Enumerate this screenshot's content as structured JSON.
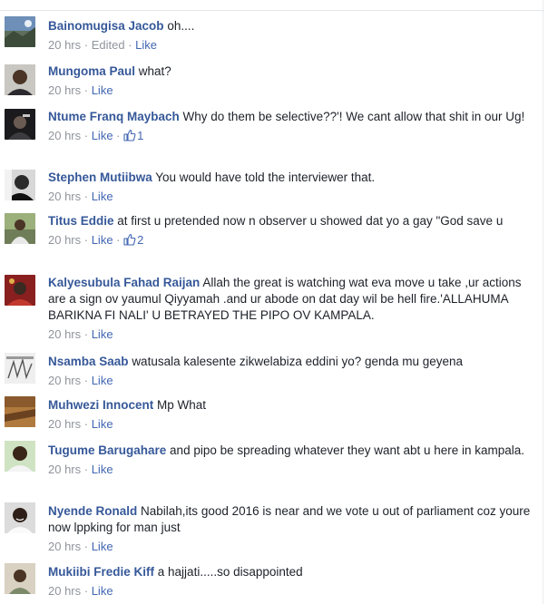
{
  "comments": [
    {
      "author": "Bainomugisa Jacob",
      "text": "oh....",
      "time": "20 hrs",
      "edited": "Edited",
      "like": "Like",
      "avatar": "landscape-photo-avatar"
    },
    {
      "author": "Mungoma Paul",
      "text": "what?",
      "time": "20 hrs",
      "like": "Like",
      "avatar": "portrait-avatar"
    },
    {
      "author": "Ntume Franq Maybach",
      "text": "Why do them be selective??'! We cant allow that shit in our Ug!",
      "time": "20 hrs",
      "like": "Like",
      "like_count": "1",
      "avatar": "dark-portrait-avatar"
    },
    {
      "author": "Stephen Mutiibwa",
      "text": "You would have told the interviewer that.",
      "time": "20 hrs",
      "like": "Like",
      "avatar": "bw-portrait-avatar"
    },
    {
      "author": "Titus Eddie",
      "text": "at first u pretended now n observer u showed dat yo a gay \"God save u",
      "time": "20 hrs",
      "like": "Like",
      "like_count": "2",
      "avatar": "outdoor-portrait-avatar"
    },
    {
      "author": "Kalyesubula Fahad Raijan",
      "text": "Allah the great is watching wat eva move u take ,ur actions are a sign ov yaumul Qiyyamah .and ur abode on dat day wil be hell fire.'ALLAHUMA BARIKNA FI NALI' U BETRAYED THE PIPO OV KAMPALA.",
      "time": "20 hrs",
      "like": "Like",
      "avatar": "red-portrait-avatar"
    },
    {
      "author": "Nsamba Saab",
      "text": "watusala kalesente zikwelabiza eddini yo? genda mu geyena",
      "time": "20 hrs",
      "like": "Like",
      "avatar": "sketch-avatar"
    },
    {
      "author": "Muhwezi Innocent",
      "text": "Mp What",
      "time": "20 hrs",
      "like": "Like",
      "avatar": "brown-texture-avatar"
    },
    {
      "author": "Tugume Barugahare",
      "text": "and pipo be spreading whatever they want abt u here in kampala.",
      "time": "20 hrs",
      "like": "Like",
      "avatar": "green-portrait-avatar"
    },
    {
      "author": "Nyende Ronald",
      "text": "Nabilah,its good 2016 is near and we vote u out of parliament coz youre now lppking for man just",
      "time": "20 hrs",
      "like": "Like",
      "avatar": "smiling-portrait-avatar"
    },
    {
      "author": "Mukiibi Fredie Kiff",
      "text": "a hajjati.....so disappointed",
      "time": "20 hrs",
      "like": "Like",
      "avatar": "light-portrait-avatar"
    }
  ],
  "colors": {
    "author_link": "#365899",
    "action_link": "#4267b2",
    "meta_gray": "#90949c",
    "text": "#1d2129"
  }
}
